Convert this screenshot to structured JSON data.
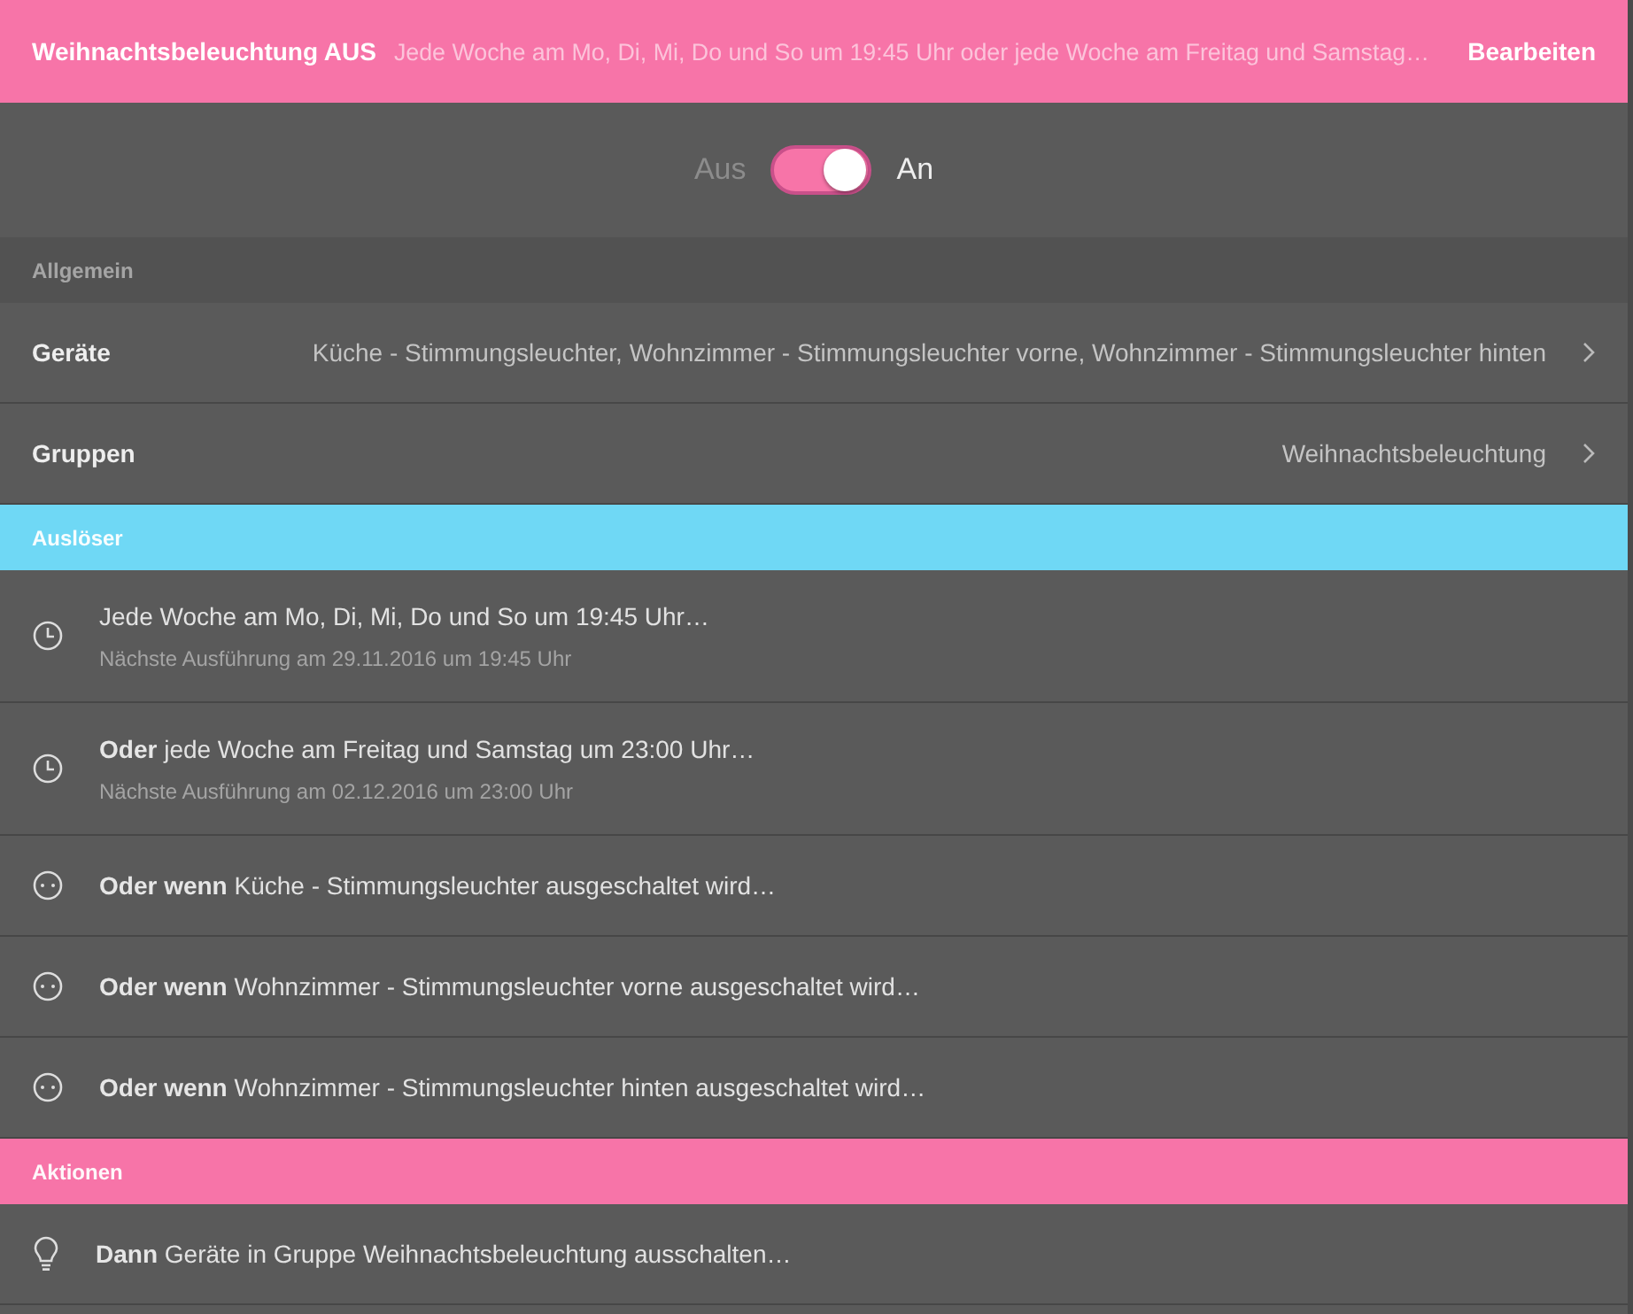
{
  "header": {
    "title": "Weihnachtsbeleuchtung AUS",
    "summary": "Jede Woche am Mo, Di, Mi, Do und So um 19:45 Uhr oder jede Woche am Freitag und Samstag…",
    "edit": "Bearbeiten"
  },
  "toggle": {
    "off_label": "Aus",
    "on_label": "An",
    "on": true
  },
  "sections": [
    {
      "title": "Allgemein",
      "color": "#525252",
      "items": [
        {
          "kind": "setting",
          "label": "Geräte",
          "value": "Küche - Stimmungsleuchter, Wohnzimmer - Stimmungsleuchter vorne, Wohnzimmer - Stimmungsleuchter hinten"
        },
        {
          "kind": "setting",
          "label": "Gruppen",
          "value": "Weihnachtsbeleuchtung"
        }
      ]
    },
    {
      "title": "Auslöser",
      "color": "#6fd8f5",
      "items": [
        {
          "kind": "time",
          "text": "Jede Woche am Mo, Di, Mi, Do und So um 19:45 Uhr…",
          "sub": "Nächste Ausführung am 29.11.2016 um 19:45 Uhr"
        },
        {
          "kind": "time",
          "text": "**Oder** jede Woche am Freitag und Samstag um 23:00 Uhr…",
          "sub": "Nächste Ausführung am 02.12.2016 um 23:00 Uhr"
        },
        {
          "kind": "device",
          "text": "**Oder wenn** Küche - Stimmungsleuchter ausgeschaltet wird…"
        },
        {
          "kind": "device",
          "text": "**Oder wenn** Wohnzimmer - Stimmungsleuchter vorne ausgeschaltet wird…"
        },
        {
          "kind": "device",
          "text": "**Oder wenn** Wohnzimmer - Stimmungsleuchter hinten ausgeschaltet wird…"
        }
      ]
    },
    {
      "title": "Aktionen",
      "color": "#f774a8",
      "items": [
        {
          "kind": "action",
          "text": "**Dann** Geräte in Gruppe Weihnachtsbeleuchtung ausschalten…"
        }
      ]
    }
  ]
}
